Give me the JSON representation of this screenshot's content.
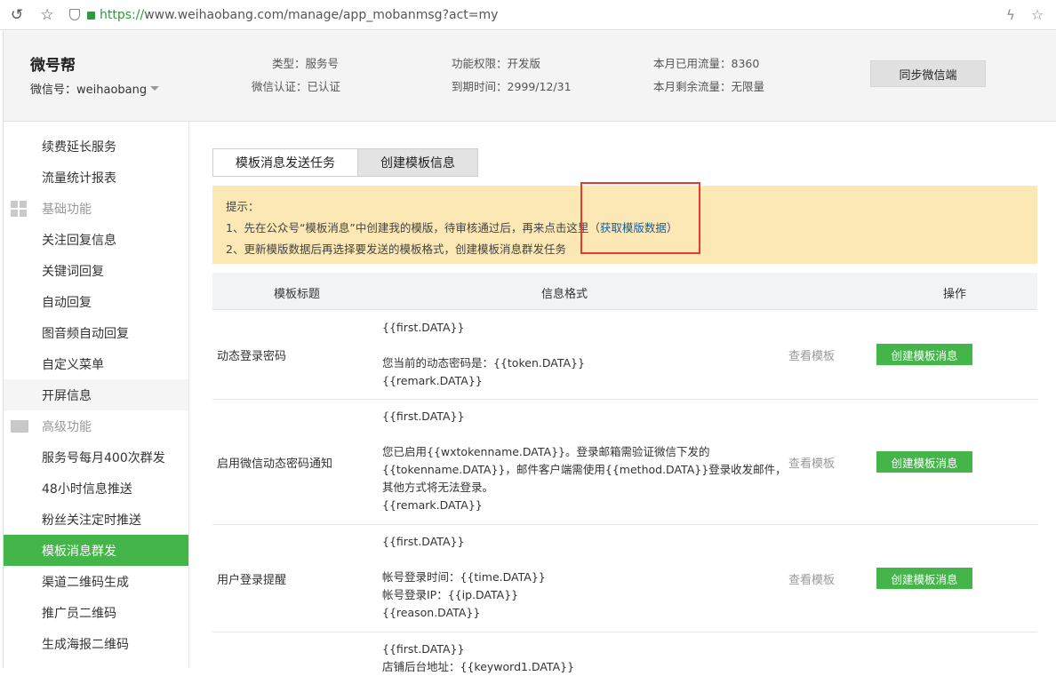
{
  "browser": {
    "url_scheme": "https://",
    "url_rest": "www.weihaobang.com/manage/app_mobanmsg?act=my",
    "back_icon": "back-arrow-icon",
    "star_icon": "star-icon"
  },
  "header": {
    "brand": "微号帮",
    "account": "微信号：weihaobang",
    "type": "类型：服务号",
    "verify": "微信认证：已认证",
    "permission": "功能权限：开发版",
    "expire": "到期时间：2999/12/31",
    "used_traffic": "本月已用流量：8360",
    "remaining_traffic": "本月剩余流量：无限量",
    "sync_button": "同步微信端"
  },
  "sidebar": {
    "items_top": [
      "续费延长服务",
      "流量统计报表"
    ],
    "group_basic": "基础功能",
    "items_basic": [
      "关注回复信息",
      "关键词回复",
      "自动回复",
      "图音频自动回复",
      "自定义菜单",
      "开屏信息"
    ],
    "group_advanced": "高级功能",
    "items_advanced": [
      "服务号每月400次群发",
      "48小时信息推送",
      "粉丝关注定时推送",
      "模板消息群发",
      "渠道二维码生成",
      "推广员二维码",
      "生成海报二维码"
    ]
  },
  "tabs": [
    "模板消息发送任务",
    "创建模板信息"
  ],
  "tip": {
    "label": "提示：",
    "line1_prefix": "1、先在公众号“模板消息”中创建我的模版，待审核通过后，再来点击这里（",
    "line1_link": "获取模版数据",
    "line1_suffix": "）",
    "line2": "2、更新模版数据后再选择要发送的模板格式，创建模板消息群发任务"
  },
  "table": {
    "headers": [
      "模板标题",
      "信息格式",
      "操作"
    ],
    "view_label": "查看模板",
    "create_label": "创建模板消息",
    "rows": [
      {
        "title": "动态登录密码",
        "format": "{{first.DATA}}\n\n您当前的动态密码是：{{token.DATA}}\n{{remark.DATA}}"
      },
      {
        "title": "启用微信动态密码通知",
        "format": "{{first.DATA}}\n\n您已启用{{wxtokenname.DATA}}。登录邮箱需验证微信下发的\n{{tokenname.DATA}}，邮件客户端需使用{{method.DATA}}登录收发邮件，\n其他方式将无法登录。\n{{remark.DATA}}"
      },
      {
        "title": "用户登录提醒",
        "format": "{{first.DATA}}\n\n帐号登录时间：{{time.DATA}}\n帐号登录IP：{{ip.DATA}}\n{{reason.DATA}}"
      },
      {
        "title": "",
        "format": "{{first.DATA}}\n店铺后台地址：{{keyword1.DATA}}"
      }
    ]
  }
}
